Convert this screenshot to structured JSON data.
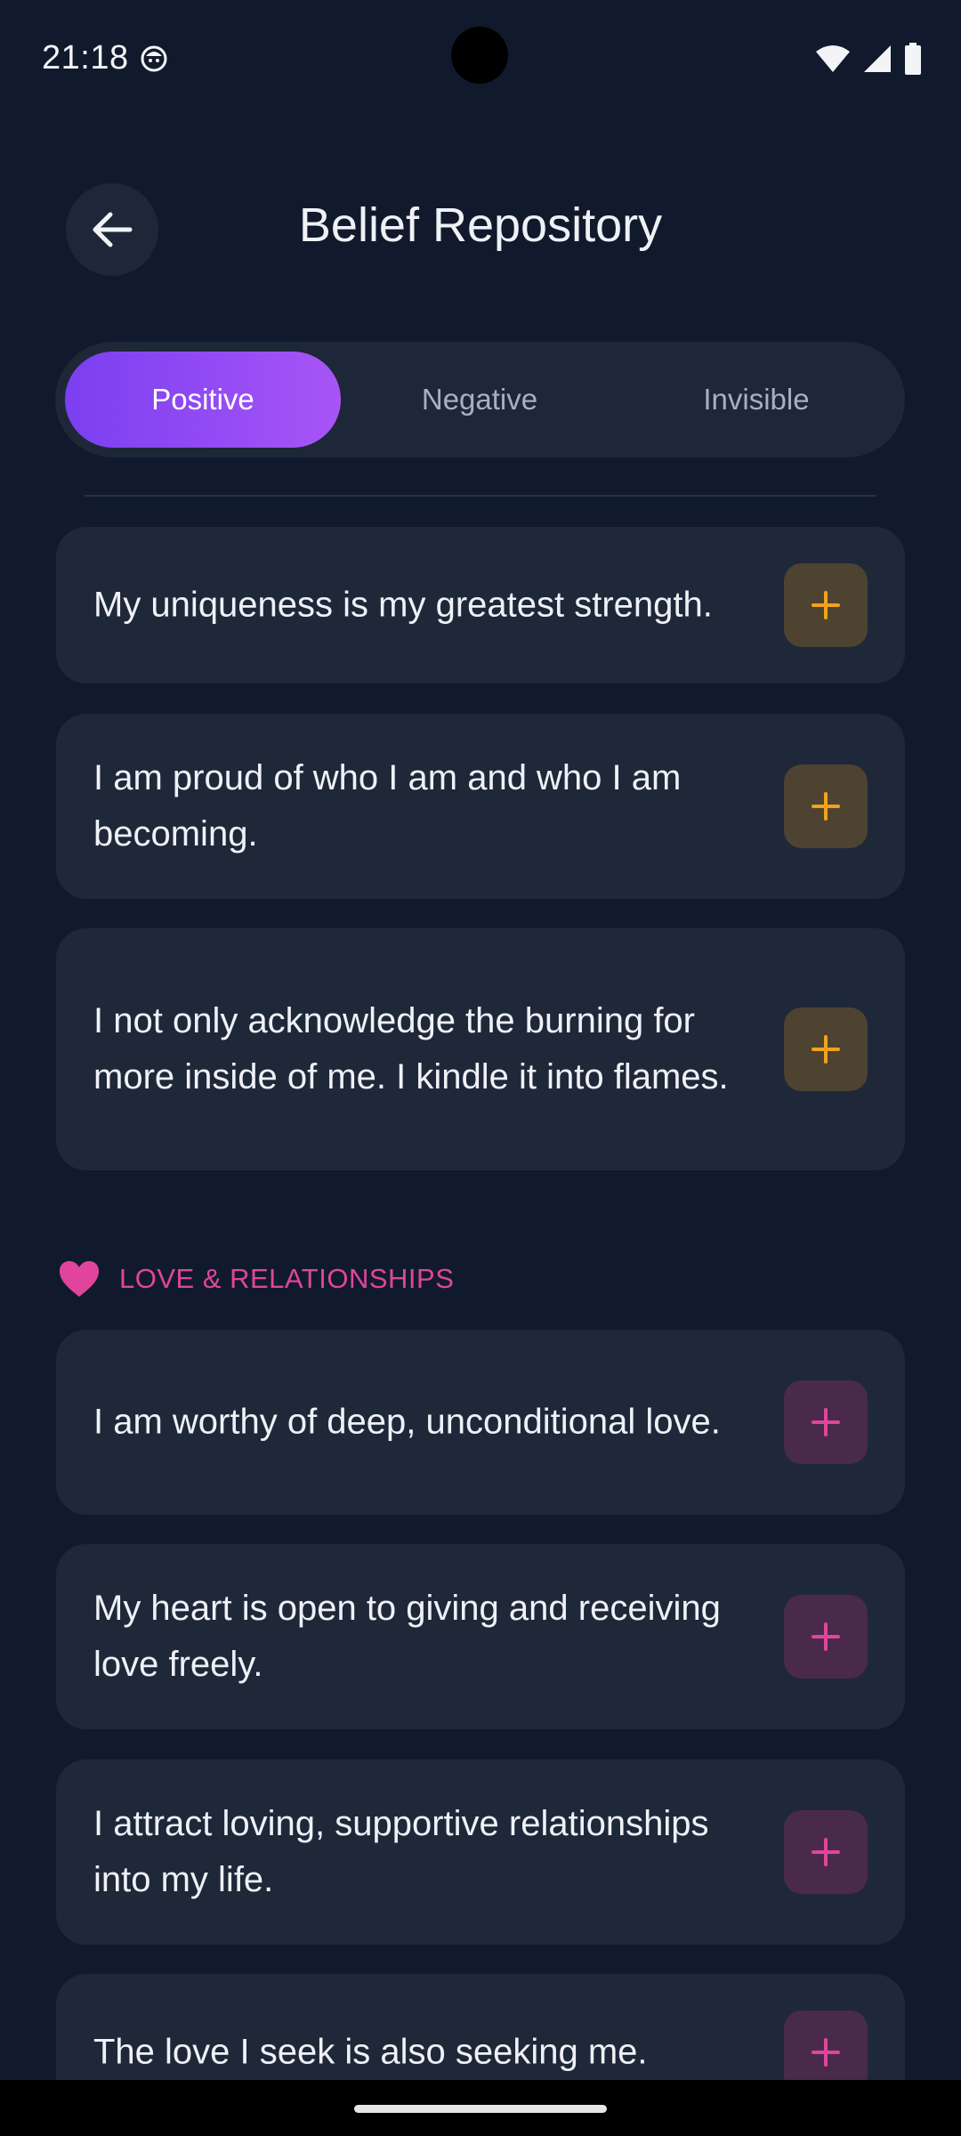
{
  "status": {
    "time": "21:18",
    "icons": [
      "face-icon",
      "wifi-icon",
      "signal-icon",
      "battery-icon"
    ]
  },
  "header": {
    "title": "Belief Repository",
    "back_icon": "arrow-left-icon"
  },
  "tabs": [
    {
      "label": "Positive",
      "active": true
    },
    {
      "label": "Negative",
      "active": false
    },
    {
      "label": "Invisible",
      "active": false
    }
  ],
  "colors": {
    "accent_gold": "#f2a21c",
    "accent_pink": "#e0459b",
    "active_tab_start": "#7b3ff0",
    "active_tab_end": "#a855f7",
    "background": "#111a2c",
    "card": "#1f2839"
  },
  "beliefs_top": [
    {
      "text": "My uniqueness is my greatest strength."
    },
    {
      "text": "I am proud of who I am and who I am becoming."
    },
    {
      "text": "I not only acknowledge the burning for more inside of me. I kindle it into flames."
    }
  ],
  "sections": [
    {
      "label": "LOVE & RELATIONSHIPS",
      "icon": "heart-icon",
      "items": [
        {
          "text": "I am worthy of deep, unconditional love."
        },
        {
          "text": "My heart is open to giving and receiving love freely."
        },
        {
          "text": "I attract loving, supportive relationships into my life."
        },
        {
          "text": "The love I seek is also seeking me."
        }
      ]
    }
  ]
}
